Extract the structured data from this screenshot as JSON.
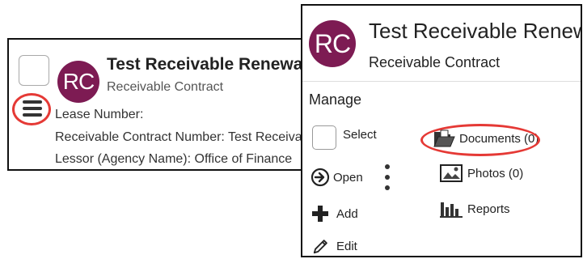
{
  "background_card": {
    "avatar_initials": "RC",
    "title": "Test Receivable Renewal",
    "subtitle": "Receivable Contract",
    "fields": [
      "Lease Number:",
      "Receivable Contract Number: Test Receivable",
      "Lessor (Agency Name): Office of Finance"
    ]
  },
  "panel": {
    "avatar_initials": "RC",
    "title": "Test Receivable Renewal",
    "subtitle": "Receivable Contract",
    "section_title": "Manage",
    "actions_left": [
      {
        "label": "Select",
        "icon": "checkbox"
      },
      {
        "label": "Open",
        "icon": "circle-arrow-right-icon"
      },
      {
        "label": "Add",
        "icon": "plus-icon"
      },
      {
        "label": "Edit",
        "icon": "pencil-icon"
      }
    ],
    "actions_right": [
      {
        "label": "Documents (0)",
        "icon": "folder-open-icon"
      },
      {
        "label": "Photos (0)",
        "icon": "photo-icon"
      },
      {
        "label": "Reports",
        "icon": "bar-chart-icon"
      }
    ]
  },
  "colors": {
    "avatar": "#7d1b53",
    "highlight": "#e53935"
  }
}
